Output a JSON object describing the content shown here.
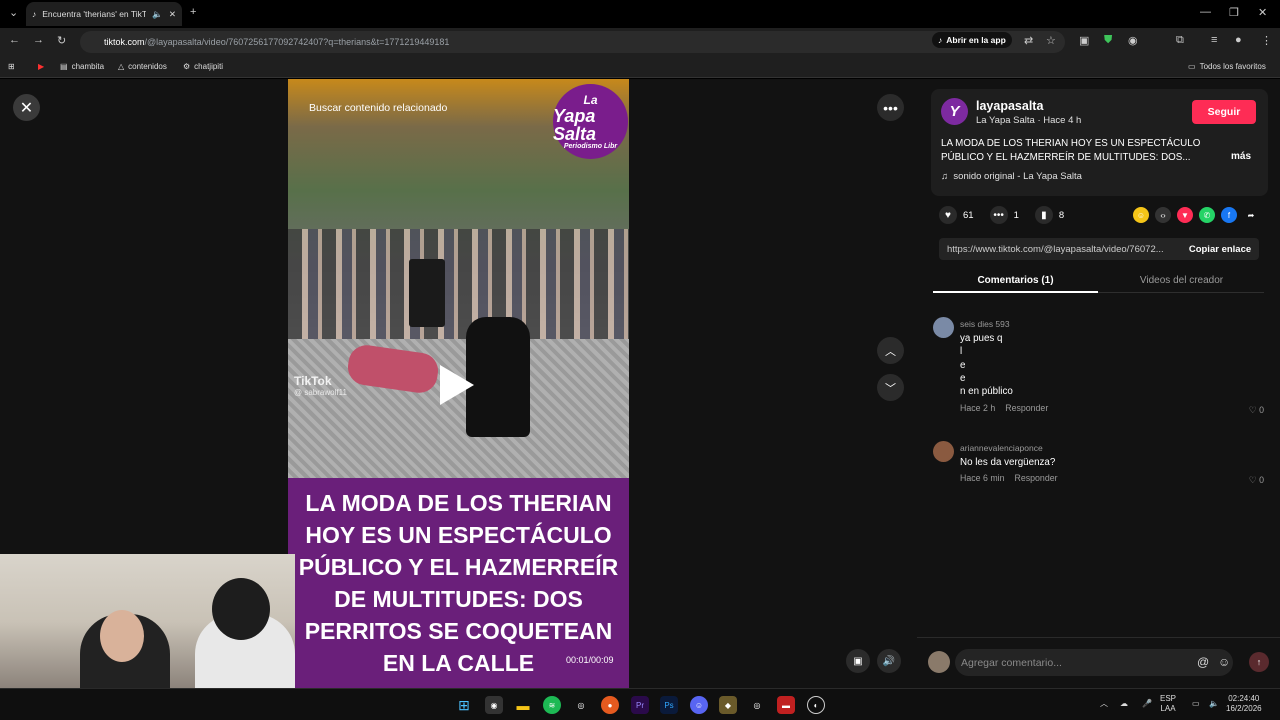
{
  "browser": {
    "tab_title": "Encuentra 'therians' en TikTok",
    "url_domain": "tiktok.com",
    "url_path": "/@layapasalta/video/7607256177092742407?q=therians&t=1771219449181",
    "open_in_app": "Abrir en la app",
    "bookmarks": [
      "chambita",
      "contenidos",
      "chatjipiti"
    ],
    "all_favorites": "Todos los favoritos"
  },
  "video": {
    "search_related": "Buscar contenido relacionado",
    "logo_top": "La",
    "logo_main": "Yapa Salta",
    "logo_sub": "Periodismo Libr",
    "watermark": "TikTok",
    "watermark_user": "@ sabrawolf11",
    "caption": "LA MODA DE LOS THERIAN HOY ES UN ESPECTÁCULO PÚBLICO Y EL HAZMERREÍR DE MULTITUDES: DOS PERRITOS SE COQUETEAN EN LA CALLE",
    "time": "00:01/00:09"
  },
  "panel": {
    "username": "layapasalta",
    "display_name": "La Yapa Salta",
    "posted": "Hace 4 h",
    "follow": "Seguir",
    "description": "LA MODA DE LOS THERIAN HOY ES UN ESPECTÁCULO PÚBLICO Y EL HAZMERREÍR DE MULTITUDES: DOS...",
    "more": "más",
    "sound": "sonido original - La Yapa Salta",
    "likes": "61",
    "comments_count": "1",
    "saves": "8",
    "link": "https://www.tiktok.com/@layapasalta/video/76072...",
    "copy_link": "Copiar enlace",
    "tab_comments": "Comentarios (1)",
    "tab_creator": "Videos del creador",
    "comment_placeholder": "Agregar comentario..."
  },
  "comments": [
    {
      "user": "seis dies 593",
      "text": "ya pues q\nl\ne\ne\nn en público",
      "time": "Hace 2 h",
      "reply": "Responder",
      "likes": "0"
    },
    {
      "user": "ariannevalenciaponce",
      "text": "No les da vergüenza?",
      "time": "Hace 6 min",
      "reply": "Responder",
      "likes": "0"
    }
  ],
  "taskbar": {
    "lang1": "ESP",
    "lang2": "LAA",
    "clock_time": "02:24:40",
    "clock_date": "16/2/2026"
  }
}
